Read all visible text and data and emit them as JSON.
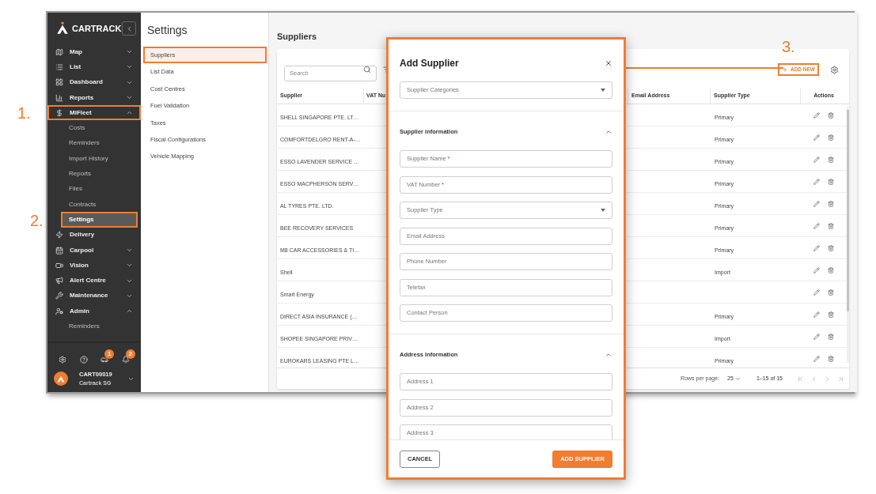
{
  "callouts": [
    {
      "label": "1."
    },
    {
      "label": "2."
    },
    {
      "label": "3."
    }
  ],
  "sidebar": {
    "brand": "CARTRACK",
    "items": [
      {
        "label": "Map",
        "expanded": false,
        "annotated": false
      },
      {
        "label": "List",
        "expanded": false,
        "annotated": false
      },
      {
        "label": "Dashboard",
        "expanded": false,
        "annotated": false
      },
      {
        "label": "Reports",
        "expanded": false,
        "annotated": false
      },
      {
        "label": "MiFleet",
        "expanded": true,
        "annotated": true,
        "children": [
          {
            "label": "Costs",
            "selected": false,
            "annotated": false
          },
          {
            "label": "Reminders",
            "selected": false,
            "annotated": false
          },
          {
            "label": "Import History",
            "selected": false,
            "annotated": false
          },
          {
            "label": "Reports",
            "selected": false,
            "annotated": false
          },
          {
            "label": "Files",
            "selected": false,
            "annotated": false
          },
          {
            "label": "Contracts",
            "selected": false,
            "annotated": false
          },
          {
            "label": "Settings",
            "selected": true,
            "annotated": true
          }
        ]
      },
      {
        "label": "Delivery",
        "annotated": false
      },
      {
        "label": "Carpool",
        "expanded": false,
        "annotated": false
      },
      {
        "label": "Vision",
        "expanded": false,
        "annotated": false
      },
      {
        "label": "Alert Centre",
        "expanded": false,
        "annotated": false
      },
      {
        "label": "Maintenance",
        "expanded": false,
        "annotated": false
      },
      {
        "label": "Admin",
        "expanded": true,
        "annotated": false,
        "children": [
          {
            "label": "Reminders",
            "selected": false,
            "annotated": false
          }
        ]
      }
    ],
    "notification_badges": [
      "1",
      "2"
    ],
    "user": {
      "account": "CART00019",
      "company": "Cartrack SG"
    }
  },
  "settings_panel": {
    "title": "Settings",
    "items": [
      {
        "label": "Suppliers",
        "selected": true,
        "annotated": true
      },
      {
        "label": "List Data",
        "selected": false,
        "annotated": false
      },
      {
        "label": "Cost Centres",
        "selected": false,
        "annotated": false
      },
      {
        "label": "Fuel Validation",
        "selected": false,
        "annotated": false
      },
      {
        "label": "Taxes",
        "selected": false,
        "annotated": false
      },
      {
        "label": "Fiscal Configurations",
        "selected": false,
        "annotated": false
      },
      {
        "label": "Vehicle Mapping",
        "selected": false,
        "annotated": false
      }
    ]
  },
  "main": {
    "title": "Suppliers",
    "search": {
      "placeholder": "Search"
    },
    "add_button": {
      "label": "ADD NEW",
      "annotated": true
    },
    "table": {
      "columns": [
        "Supplier",
        "VAT Nu",
        "Email Address",
        "Supplier Type",
        "Actions"
      ],
      "rows": [
        {
          "supplier": "SHELL SINGAPORE PTE. LT…",
          "type": "Primary"
        },
        {
          "supplier": "COMFORTDELGRO RENT-A-…",
          "type": "Primary"
        },
        {
          "supplier": "ESSO LAVENDER SERVICE …",
          "type": "Primary"
        },
        {
          "supplier": "ESSO MACPHERSON SERV…",
          "type": "Primary"
        },
        {
          "supplier": "AL TYRES PTE. LTD.",
          "type": "Primary"
        },
        {
          "supplier": "BEE RECOVERY SERVICES",
          "type": "Primary"
        },
        {
          "supplier": "M8 CAR ACCESSORIES & TI…",
          "type": "Primary"
        },
        {
          "supplier": "Shell",
          "type": "Import"
        },
        {
          "supplier": "Smart Energy"
        },
        {
          "supplier": "DIRECT ASIA INSURANCE (…",
          "type": "Primary"
        },
        {
          "supplier": "SHOPEE SINGAPORE PRIV…",
          "type": "Import"
        },
        {
          "supplier": "EUROKARS LEASING PTE L…",
          "type": "Primary"
        }
      ]
    },
    "pagination": {
      "rows_per_page_label": "Rows per page:",
      "rows_per_page": "25",
      "range": "1–15 of 15"
    }
  },
  "modal": {
    "title": "Add Supplier",
    "category_select": {
      "label": "Supplier Categories"
    },
    "sections": [
      {
        "title": "Supplier information",
        "expanded": true,
        "fields": [
          {
            "kind": "text",
            "label": "Supplier Name",
            "required_mark": "*"
          },
          {
            "kind": "text",
            "label": "VAT Number",
            "required_mark": "*"
          },
          {
            "kind": "select",
            "label": "Supplier Type"
          },
          {
            "kind": "text",
            "label": "Email Address"
          },
          {
            "kind": "text",
            "label": "Phone Number"
          },
          {
            "kind": "text",
            "label": "Telefax"
          },
          {
            "kind": "text",
            "label": "Contact Person"
          }
        ]
      },
      {
        "title": "Address Information",
        "expanded": true,
        "fields": [
          {
            "kind": "text",
            "label": "Address 1"
          },
          {
            "kind": "text",
            "label": "Address 2"
          },
          {
            "kind": "text",
            "label": "Address 3"
          }
        ]
      }
    ],
    "buttons": [
      {
        "label": "CANCEL",
        "kind": "outlined"
      },
      {
        "label": "ADD SUPPLIER",
        "kind": "primary"
      }
    ]
  }
}
